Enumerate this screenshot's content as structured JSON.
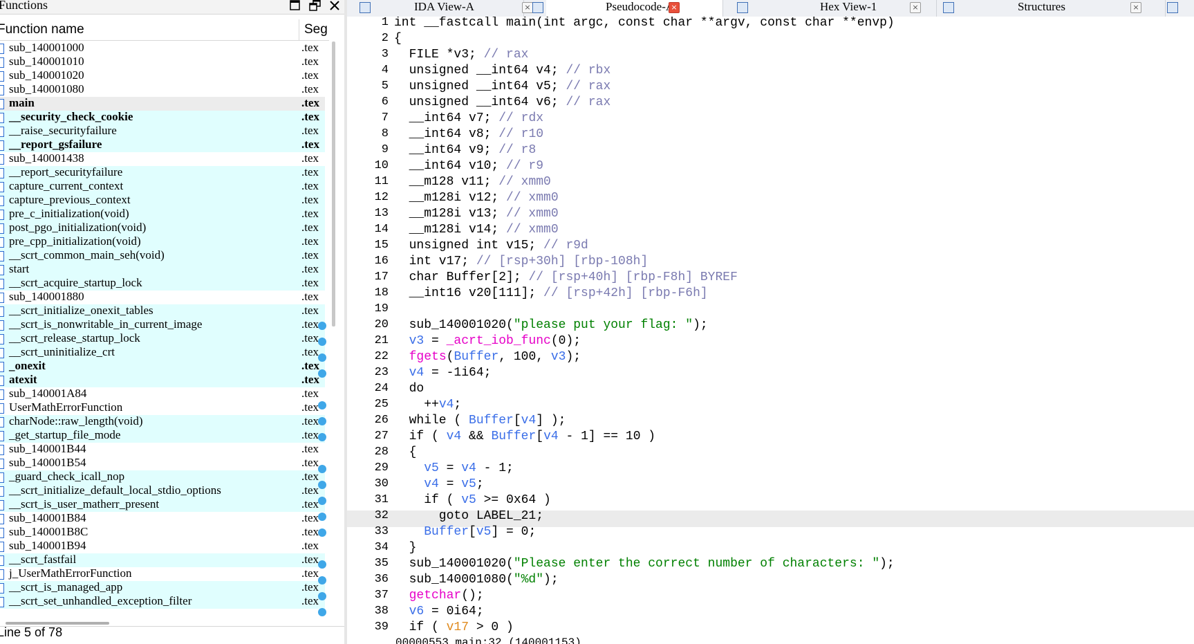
{
  "functions_window": {
    "title": "Functions",
    "column_name": "Function name",
    "column_segment": "Seg",
    "status": "Line 5 of 78",
    "rows": [
      {
        "name": "sub_140001000",
        "seg": ".tex",
        "bold": false,
        "style": ""
      },
      {
        "name": "sub_140001010",
        "seg": ".tex",
        "bold": false,
        "style": ""
      },
      {
        "name": "sub_140001020",
        "seg": ".tex",
        "bold": false,
        "style": ""
      },
      {
        "name": "sub_140001080",
        "seg": ".tex",
        "bold": false,
        "style": ""
      },
      {
        "name": "main",
        "seg": ".tex",
        "bold": true,
        "style": "selected"
      },
      {
        "name": "__security_check_cookie",
        "seg": ".tex",
        "bold": true,
        "style": "cyan"
      },
      {
        "name": "__raise_securityfailure",
        "seg": ".tex",
        "bold": false,
        "style": "cyan"
      },
      {
        "name": "__report_gsfailure",
        "seg": ".tex",
        "bold": true,
        "style": "cyan"
      },
      {
        "name": "sub_140001438",
        "seg": ".tex",
        "bold": false,
        "style": ""
      },
      {
        "name": "__report_securityfailure",
        "seg": ".tex",
        "bold": false,
        "style": "cyan"
      },
      {
        "name": "capture_current_context",
        "seg": ".tex",
        "bold": false,
        "style": "cyan"
      },
      {
        "name": "capture_previous_context",
        "seg": ".tex",
        "bold": false,
        "style": "cyan"
      },
      {
        "name": "pre_c_initialization(void)",
        "seg": ".tex",
        "bold": false,
        "style": "cyan"
      },
      {
        "name": "post_pgo_initialization(void)",
        "seg": ".tex",
        "bold": false,
        "style": "cyan"
      },
      {
        "name": "pre_cpp_initialization(void)",
        "seg": ".tex",
        "bold": false,
        "style": "cyan"
      },
      {
        "name": "__scrt_common_main_seh(void)",
        "seg": ".tex",
        "bold": false,
        "style": "cyan"
      },
      {
        "name": "start",
        "seg": ".tex",
        "bold": false,
        "style": "cyan"
      },
      {
        "name": "__scrt_acquire_startup_lock",
        "seg": ".tex",
        "bold": false,
        "style": "cyan"
      },
      {
        "name": "sub_140001880",
        "seg": ".tex",
        "bold": false,
        "style": ""
      },
      {
        "name": "__scrt_initialize_onexit_tables",
        "seg": ".tex",
        "bold": false,
        "style": "cyan"
      },
      {
        "name": "__scrt_is_nonwritable_in_current_image",
        "seg": ".tex",
        "bold": false,
        "style": "cyan"
      },
      {
        "name": "__scrt_release_startup_lock",
        "seg": ".tex",
        "bold": false,
        "style": "cyan"
      },
      {
        "name": "__scrt_uninitialize_crt",
        "seg": ".tex",
        "bold": false,
        "style": "cyan"
      },
      {
        "name": "_onexit",
        "seg": ".tex",
        "bold": true,
        "style": "cyan"
      },
      {
        "name": "atexit",
        "seg": ".tex",
        "bold": true,
        "style": "cyan"
      },
      {
        "name": "sub_140001A84",
        "seg": ".tex",
        "bold": false,
        "style": ""
      },
      {
        "name": "UserMathErrorFunction",
        "seg": ".tex",
        "bold": false,
        "style": ""
      },
      {
        "name": "charNode::raw_length(void)",
        "seg": ".tex",
        "bold": false,
        "style": "cyan"
      },
      {
        "name": "_get_startup_file_mode",
        "seg": ".tex",
        "bold": false,
        "style": "cyan"
      },
      {
        "name": "sub_140001B44",
        "seg": ".tex",
        "bold": false,
        "style": ""
      },
      {
        "name": "sub_140001B54",
        "seg": ".tex",
        "bold": false,
        "style": ""
      },
      {
        "name": "_guard_check_icall_nop",
        "seg": ".tex",
        "bold": false,
        "style": "cyan"
      },
      {
        "name": "__scrt_initialize_default_local_stdio_options",
        "seg": ".tex",
        "bold": false,
        "style": "cyan"
      },
      {
        "name": "__scrt_is_user_matherr_present",
        "seg": ".tex",
        "bold": false,
        "style": "cyan"
      },
      {
        "name": "sub_140001B84",
        "seg": ".tex",
        "bold": false,
        "style": ""
      },
      {
        "name": "sub_140001B8C",
        "seg": ".tex",
        "bold": false,
        "style": ""
      },
      {
        "name": "sub_140001B94",
        "seg": ".tex",
        "bold": false,
        "style": ""
      },
      {
        "name": "__scrt_fastfail",
        "seg": ".tex",
        "bold": false,
        "style": "cyan"
      },
      {
        "name": "j_UserMathErrorFunction",
        "seg": ".tex",
        "bold": false,
        "style": ""
      },
      {
        "name": "__scrt_is_managed_app",
        "seg": ".tex",
        "bold": false,
        "style": "cyan"
      },
      {
        "name": "__scrt_set_unhandled_exception_filter",
        "seg": ".tex",
        "bold": false,
        "style": "cyan"
      }
    ]
  },
  "tabs": [
    {
      "label": "IDA View-A",
      "active": false
    },
    {
      "label": "Pseudocode-A",
      "active": true
    },
    {
      "label": "Hex View-1",
      "active": false
    },
    {
      "label": "Structures",
      "active": false
    }
  ],
  "tab_close_glyph": "×",
  "code_status": "00000553 main:32 (140001153)",
  "colors": {
    "variable": "#3a6ee8",
    "comment": "#7a7ab0",
    "string": "#008000",
    "library_function": "#e600c8",
    "breakpoint_dot": "#3fa7e8",
    "highlight_row": "#e0fefe"
  },
  "code_lines": [
    {
      "n": "1",
      "bp": false,
      "tokens": [
        {
          "t": "int __fastcall main(int argc, const char **argv, const char **envp)"
        }
      ]
    },
    {
      "n": "2",
      "bp": false,
      "tokens": [
        {
          "t": "{"
        }
      ]
    },
    {
      "n": "3",
      "bp": false,
      "tokens": [
        {
          "t": "  FILE *v3; "
        },
        {
          "t": "// rax",
          "c": "cmt"
        }
      ]
    },
    {
      "n": "4",
      "bp": false,
      "tokens": [
        {
          "t": "  unsigned __int64 v4; "
        },
        {
          "t": "// rbx",
          "c": "cmt"
        }
      ]
    },
    {
      "n": "5",
      "bp": false,
      "tokens": [
        {
          "t": "  unsigned __int64 v5; "
        },
        {
          "t": "// rax",
          "c": "cmt"
        }
      ]
    },
    {
      "n": "6",
      "bp": false,
      "tokens": [
        {
          "t": "  unsigned __int64 v6; "
        },
        {
          "t": "// rax",
          "c": "cmt"
        }
      ]
    },
    {
      "n": "7",
      "bp": false,
      "tokens": [
        {
          "t": "  __int64 v7; "
        },
        {
          "t": "// rdx",
          "c": "cmt"
        }
      ]
    },
    {
      "n": "8",
      "bp": false,
      "tokens": [
        {
          "t": "  __int64 v8; "
        },
        {
          "t": "// r10",
          "c": "cmt"
        }
      ]
    },
    {
      "n": "9",
      "bp": false,
      "tokens": [
        {
          "t": "  __int64 v9; "
        },
        {
          "t": "// r8",
          "c": "cmt"
        }
      ]
    },
    {
      "n": "10",
      "bp": false,
      "tokens": [
        {
          "t": "  __int64 v10; "
        },
        {
          "t": "// r9",
          "c": "cmt"
        }
      ]
    },
    {
      "n": "11",
      "bp": false,
      "tokens": [
        {
          "t": "  __m128 v11; "
        },
        {
          "t": "// xmm0",
          "c": "cmt"
        }
      ]
    },
    {
      "n": "12",
      "bp": false,
      "tokens": [
        {
          "t": "  __m128i v12; "
        },
        {
          "t": "// xmm0",
          "c": "cmt"
        }
      ]
    },
    {
      "n": "13",
      "bp": false,
      "tokens": [
        {
          "t": "  __m128i v13; "
        },
        {
          "t": "// xmm0",
          "c": "cmt"
        }
      ]
    },
    {
      "n": "14",
      "bp": false,
      "tokens": [
        {
          "t": "  __m128i v14; "
        },
        {
          "t": "// xmm0",
          "c": "cmt"
        }
      ]
    },
    {
      "n": "15",
      "bp": false,
      "tokens": [
        {
          "t": "  unsigned int v15; "
        },
        {
          "t": "// r9d",
          "c": "cmt"
        }
      ]
    },
    {
      "n": "16",
      "bp": false,
      "tokens": [
        {
          "t": "  int v17; "
        },
        {
          "t": "// [rsp+30h] [rbp-108h]",
          "c": "cmt"
        }
      ]
    },
    {
      "n": "17",
      "bp": false,
      "tokens": [
        {
          "t": "  char Buffer[2]; "
        },
        {
          "t": "// [rsp+40h] [rbp-F8h] BYREF",
          "c": "cmt"
        }
      ]
    },
    {
      "n": "18",
      "bp": false,
      "tokens": [
        {
          "t": "  __int16 v20[111]; "
        },
        {
          "t": "// [rsp+42h] [rbp-F6h]",
          "c": "cmt"
        }
      ]
    },
    {
      "n": "19",
      "bp": false,
      "tokens": [
        {
          "t": ""
        }
      ]
    },
    {
      "n": "20",
      "bp": true,
      "tokens": [
        {
          "t": "  sub_140001020("
        },
        {
          "t": "\"please put your flag: \"",
          "c": "str"
        },
        {
          "t": ");"
        }
      ]
    },
    {
      "n": "21",
      "bp": true,
      "tokens": [
        {
          "t": "  "
        },
        {
          "t": "v3",
          "c": "var"
        },
        {
          "t": " = "
        },
        {
          "t": "_acrt_iob_func",
          "c": "fn"
        },
        {
          "t": "(0);"
        }
      ]
    },
    {
      "n": "22",
      "bp": true,
      "tokens": [
        {
          "t": "  "
        },
        {
          "t": "fgets",
          "c": "fn"
        },
        {
          "t": "("
        },
        {
          "t": "Buffer",
          "c": "var"
        },
        {
          "t": ", 100, "
        },
        {
          "t": "v3",
          "c": "var"
        },
        {
          "t": ");"
        }
      ]
    },
    {
      "n": "23",
      "bp": true,
      "tokens": [
        {
          "t": "  "
        },
        {
          "t": "v4",
          "c": "var"
        },
        {
          "t": " = -1i64;"
        }
      ]
    },
    {
      "n": "24",
      "bp": false,
      "tokens": [
        {
          "t": "  do"
        }
      ]
    },
    {
      "n": "25",
      "bp": true,
      "tokens": [
        {
          "t": "    ++"
        },
        {
          "t": "v4",
          "c": "var"
        },
        {
          "t": ";"
        }
      ]
    },
    {
      "n": "26",
      "bp": true,
      "tokens": [
        {
          "t": "  while ( "
        },
        {
          "t": "Buffer",
          "c": "var"
        },
        {
          "t": "["
        },
        {
          "t": "v4",
          "c": "var"
        },
        {
          "t": "] );"
        }
      ]
    },
    {
      "n": "27",
      "bp": true,
      "tokens": [
        {
          "t": "  if ( "
        },
        {
          "t": "v4",
          "c": "var"
        },
        {
          "t": " && "
        },
        {
          "t": "Buffer",
          "c": "var"
        },
        {
          "t": "["
        },
        {
          "t": "v4",
          "c": "var"
        },
        {
          "t": " - 1] == 10 )"
        }
      ]
    },
    {
      "n": "28",
      "bp": false,
      "tokens": [
        {
          "t": "  {"
        }
      ]
    },
    {
      "n": "29",
      "bp": true,
      "tokens": [
        {
          "t": "    "
        },
        {
          "t": "v5",
          "c": "var"
        },
        {
          "t": " = "
        },
        {
          "t": "v4",
          "c": "var"
        },
        {
          "t": " - 1;"
        }
      ]
    },
    {
      "n": "30",
      "bp": true,
      "tokens": [
        {
          "t": "    "
        },
        {
          "t": "v4",
          "c": "var"
        },
        {
          "t": " = "
        },
        {
          "t": "v5",
          "c": "var"
        },
        {
          "t": ";"
        }
      ]
    },
    {
      "n": "31",
      "bp": true,
      "tokens": [
        {
          "t": "    if ( "
        },
        {
          "t": "v5",
          "c": "var"
        },
        {
          "t": " >= 0x64 )"
        }
      ]
    },
    {
      "n": "32",
      "bp": true,
      "tokens": [
        {
          "t": "      goto LABEL_21;"
        }
      ]
    },
    {
      "n": "33",
      "bp": true,
      "tokens": [
        {
          "t": "    "
        },
        {
          "t": "Buffer",
          "c": "var"
        },
        {
          "t": "["
        },
        {
          "t": "v5",
          "c": "var"
        },
        {
          "t": "] = 0;"
        }
      ]
    },
    {
      "n": "34",
      "bp": false,
      "tokens": [
        {
          "t": "  }"
        }
      ]
    },
    {
      "n": "35",
      "bp": true,
      "tokens": [
        {
          "t": "  sub_140001020("
        },
        {
          "t": "\"Please enter the correct number of characters: \"",
          "c": "str"
        },
        {
          "t": ");"
        }
      ]
    },
    {
      "n": "36",
      "bp": true,
      "tokens": [
        {
          "t": "  sub_140001080("
        },
        {
          "t": "\"%d\"",
          "c": "str"
        },
        {
          "t": ");"
        }
      ]
    },
    {
      "n": "37",
      "bp": true,
      "tokens": [
        {
          "t": "  "
        },
        {
          "t": "getchar",
          "c": "fn"
        },
        {
          "t": "();"
        }
      ]
    },
    {
      "n": "38",
      "bp": true,
      "tokens": [
        {
          "t": "  "
        },
        {
          "t": "v6",
          "c": "var"
        },
        {
          "t": " = 0i64;"
        }
      ]
    },
    {
      "n": "39",
      "bp": false,
      "tokens": [
        {
          "t": "  if ( "
        },
        {
          "t": "v17",
          "c": "var2"
        },
        {
          "t": " > 0 )"
        }
      ]
    }
  ]
}
